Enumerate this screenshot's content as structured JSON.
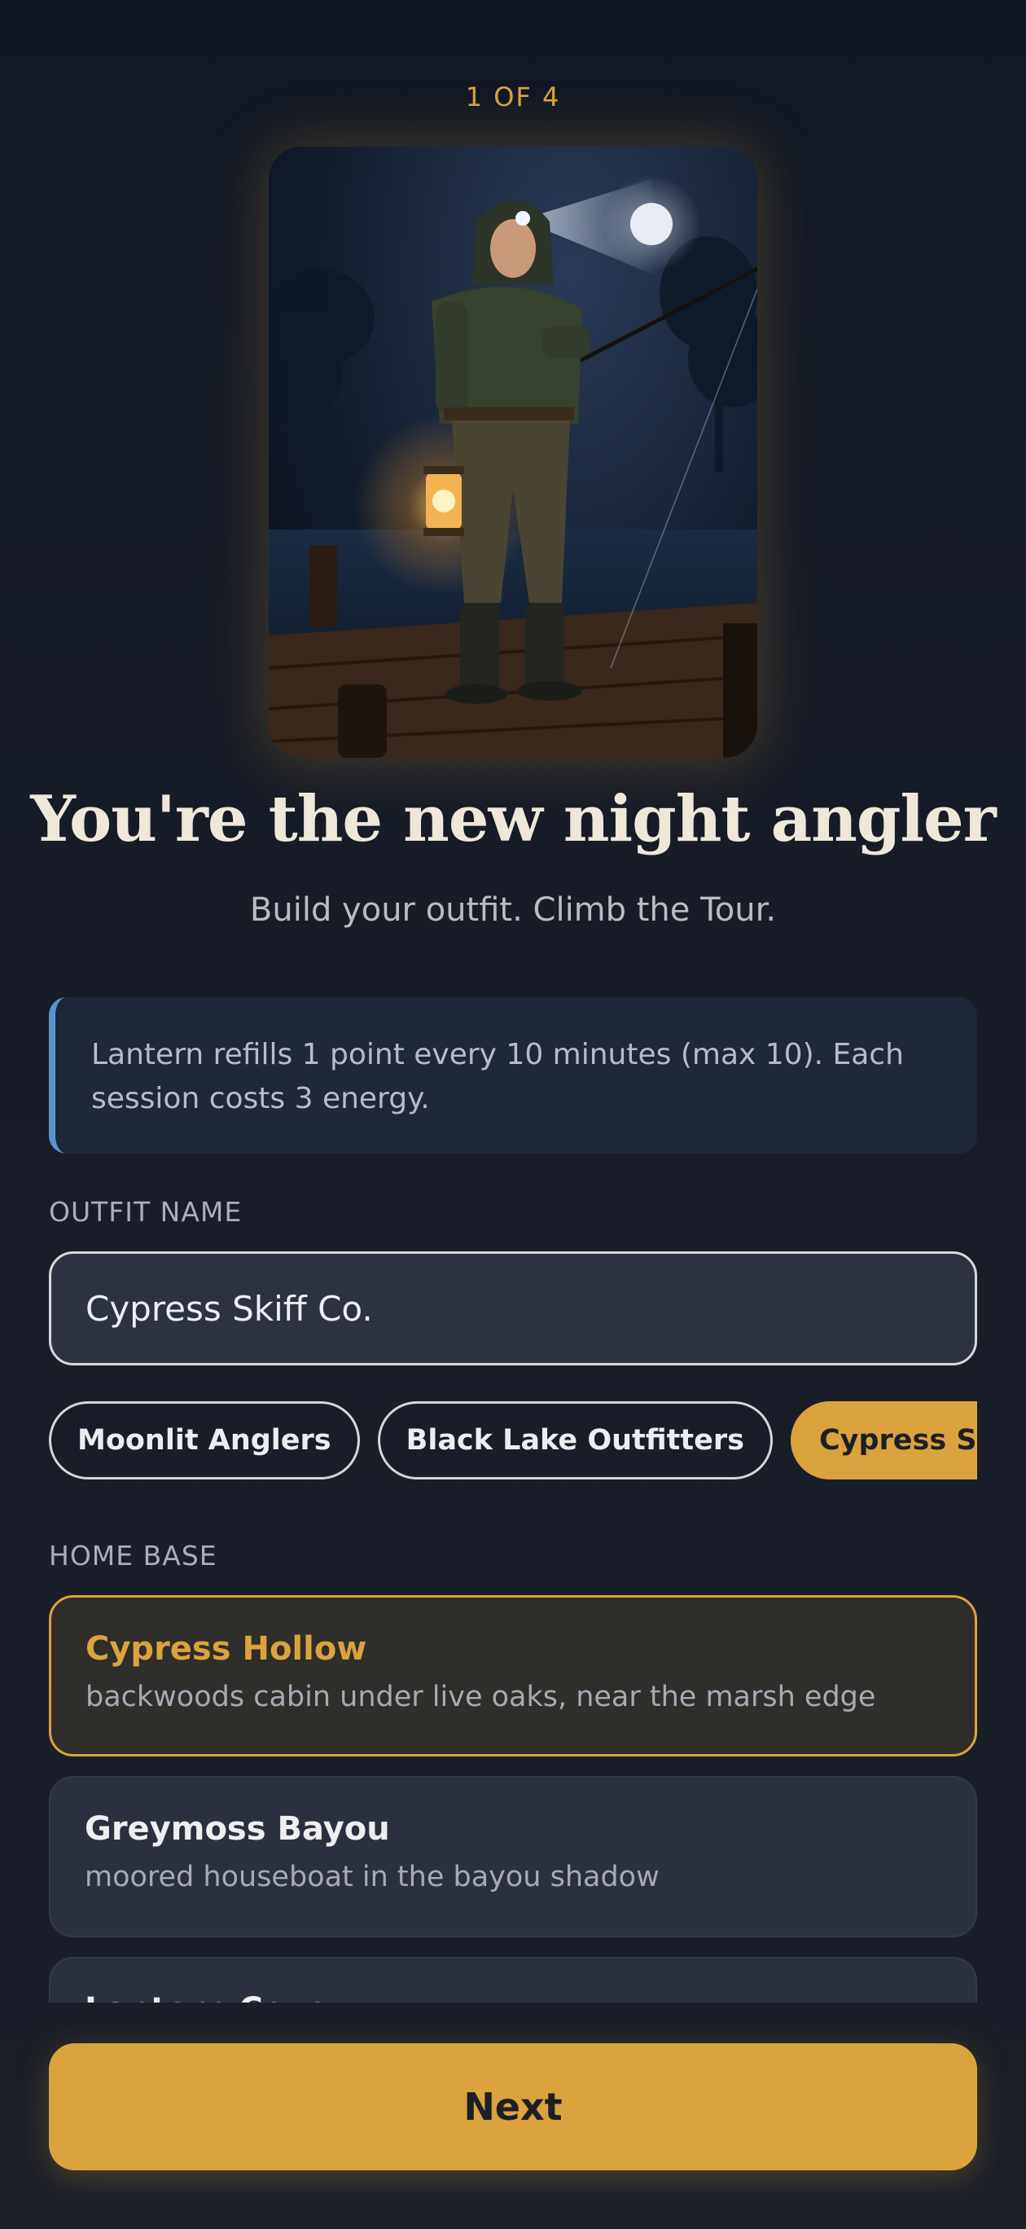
{
  "progress": {
    "step_label": "1 OF 4",
    "current": 1,
    "total": 4
  },
  "hero": {
    "image_name": "night-angler-illustration"
  },
  "heading": {
    "title": "You're the new night angler",
    "subtitle": "Build your outfit. Climb the Tour."
  },
  "info": {
    "text": "Lantern refills 1 point every 10 minutes (max 10). Each session costs 3 energy."
  },
  "outfit": {
    "label": "OUTFIT NAME",
    "value": "Cypress Skiff Co.",
    "suggestions": [
      {
        "label": "Moonlit Anglers",
        "selected": false
      },
      {
        "label": "Black Lake Outfitters",
        "selected": false
      },
      {
        "label": "Cypress Skiff Co.",
        "selected": true
      }
    ]
  },
  "home_base": {
    "label": "HOME BASE",
    "options": [
      {
        "name": "Cypress Hollow",
        "description": "backwoods cabin under live oaks, near the marsh edge",
        "selected": true
      },
      {
        "name": "Greymoss Bayou",
        "description": "moored houseboat in the bayou shadow",
        "selected": false
      },
      {
        "name": "Lantern Cove",
        "description": "",
        "selected": false
      }
    ]
  },
  "actions": {
    "next_label": "Next"
  },
  "colors": {
    "accent": "#dba33e",
    "info_border": "#5a93cf",
    "background": "#171c27"
  }
}
